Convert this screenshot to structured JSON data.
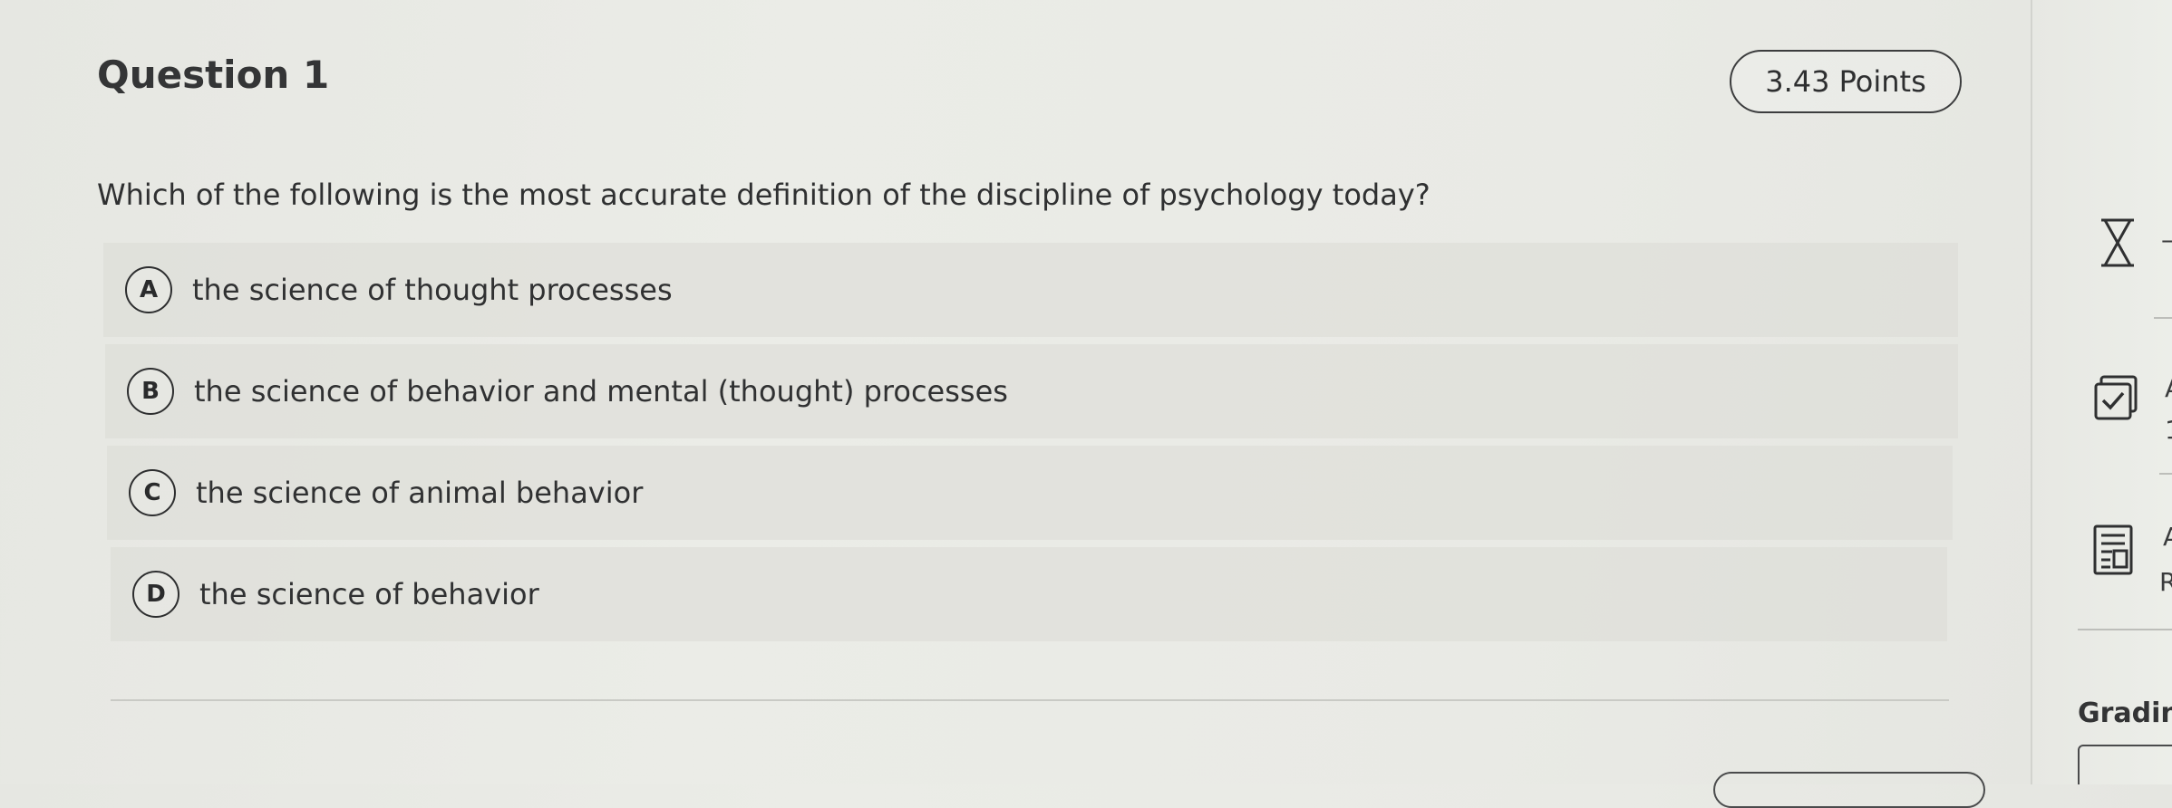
{
  "question": {
    "title": "Question 1",
    "points": "3.43 Points",
    "text": "Which of the following is the most accurate definition of the discipline of psychology today?"
  },
  "options": [
    {
      "letter": "A",
      "text": "the science of thought processes"
    },
    {
      "letter": "B",
      "text": "the science of behavior and mental (thought) processes"
    },
    {
      "letter": "C",
      "text": "the science of animal behavior"
    },
    {
      "letter": "D",
      "text": "the science of behavior"
    }
  ],
  "sidebar": {
    "items": [
      {
        "icon": "hourglass-icon",
        "text": "—"
      },
      {
        "icon": "checkbox-icon",
        "text": "A",
        "subtext": "1"
      },
      {
        "icon": "calculator-icon",
        "text": "A",
        "subtext": "R"
      }
    ],
    "grading_label": "Gradin"
  }
}
